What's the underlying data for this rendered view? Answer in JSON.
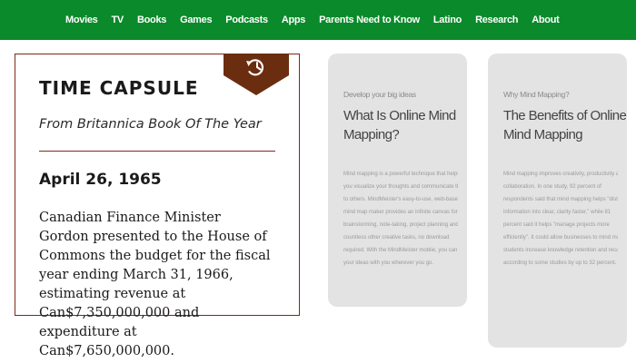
{
  "nav": {
    "items": [
      "Movies",
      "TV",
      "Books",
      "Games",
      "Podcasts",
      "Apps",
      "Parents Need to Know",
      "Latino",
      "Research",
      "About"
    ],
    "background_color": "#0a8a2a"
  },
  "time_capsule": {
    "badge_icon": "history-icon",
    "title": "TIME CAPSULE",
    "subtitle": "From Britannica Book Of The Year",
    "date": "April 26, 1965",
    "body_lines": [
      "Canadian Finance Minister",
      "Gordon presented to the House of",
      "Commons the budget for the fiscal",
      "year ending March 31, 1966,",
      "estimating revenue at",
      "Can$7,350,000,000 and",
      "expenditure at",
      "Can$7,650,000,000."
    ],
    "accent_color": "#7a2a1a"
  },
  "cards": [
    {
      "kicker": "Develop your big ideas",
      "title_lines": [
        "What Is Online Mind",
        "Mapping?"
      ],
      "text_lines": [
        "Mind mapping is a powerful technique that helps",
        "you visualize your thoughts and communicate them",
        "to others. MindMeister's easy-to-use, web-based",
        "mind map maker provides an infinite canvas for",
        "brainstorming, note-taking, project planning and",
        "countless other creative tasks, no download",
        "required. With the MindMeister mobile, you can take",
        "your ideas with you wherever you go."
      ]
    },
    {
      "kicker": "Why Mind Mapping?",
      "title_lines": [
        "The Benefits of Online",
        "Mind Mapping"
      ],
      "text_lines": [
        "Mind mapping improves creativity, productivity and",
        "collaboration. In one study, 92 percent of",
        "respondents said that mind mapping helps \"distill",
        "information into clear, clarity faster,\" while 81",
        "percent said it helps \"manage projects more",
        "efficiently\". It could allow businesses to mind maps help",
        "students increase knowledge retention and recall,",
        "according to some studies by up to 32 percent."
      ]
    }
  ]
}
